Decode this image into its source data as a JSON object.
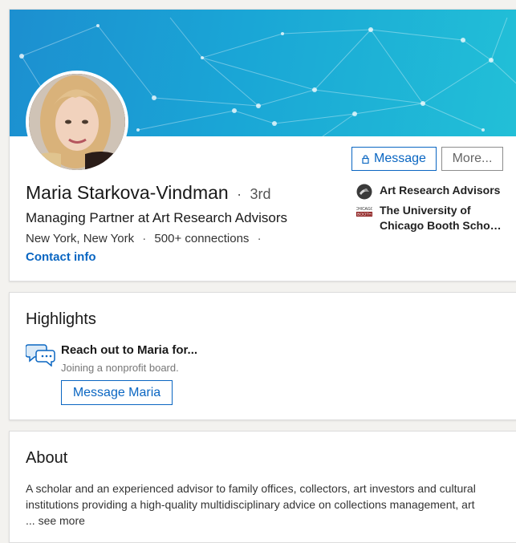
{
  "profile": {
    "name": "Maria Starkova-Vindman",
    "degree_separator": "·",
    "degree": "3rd",
    "headline": "Managing Partner at Art Research Advisors",
    "location": "New York, New York",
    "sep1": "·",
    "connections": "500+ connections",
    "sep2": "·",
    "contact_link": "Contact info",
    "buttons": {
      "message_label": "Message",
      "more_label": "More..."
    },
    "organizations": [
      {
        "name": "Art Research Advisors",
        "logo": "art-research-advisors-logo"
      },
      {
        "name_line1": "The University of",
        "name_line2": "Chicago Booth School of Business",
        "logo": "chicago-booth-logo",
        "logo_text": "CHICAGO BOOTH"
      }
    ]
  },
  "highlights": {
    "title": "Highlights",
    "item_title": "Reach out to Maria for...",
    "item_subtitle": "Joining a nonprofit board.",
    "button_label": "Message Maria",
    "icon": "speech-bubbles-icon"
  },
  "about": {
    "title": "About",
    "text_line1": "A scholar and an experienced advisor to family offices, collectors, art investors and cultural",
    "text_line2": "institutions providing a high-quality multidisciplinary advice on collections management, art",
    "text_line3_prefix": "... ",
    "see_more": "see more"
  },
  "colors": {
    "accent": "#0a66c2",
    "banner_start": "#1c8fd0",
    "banner_end": "#22c0d7"
  }
}
